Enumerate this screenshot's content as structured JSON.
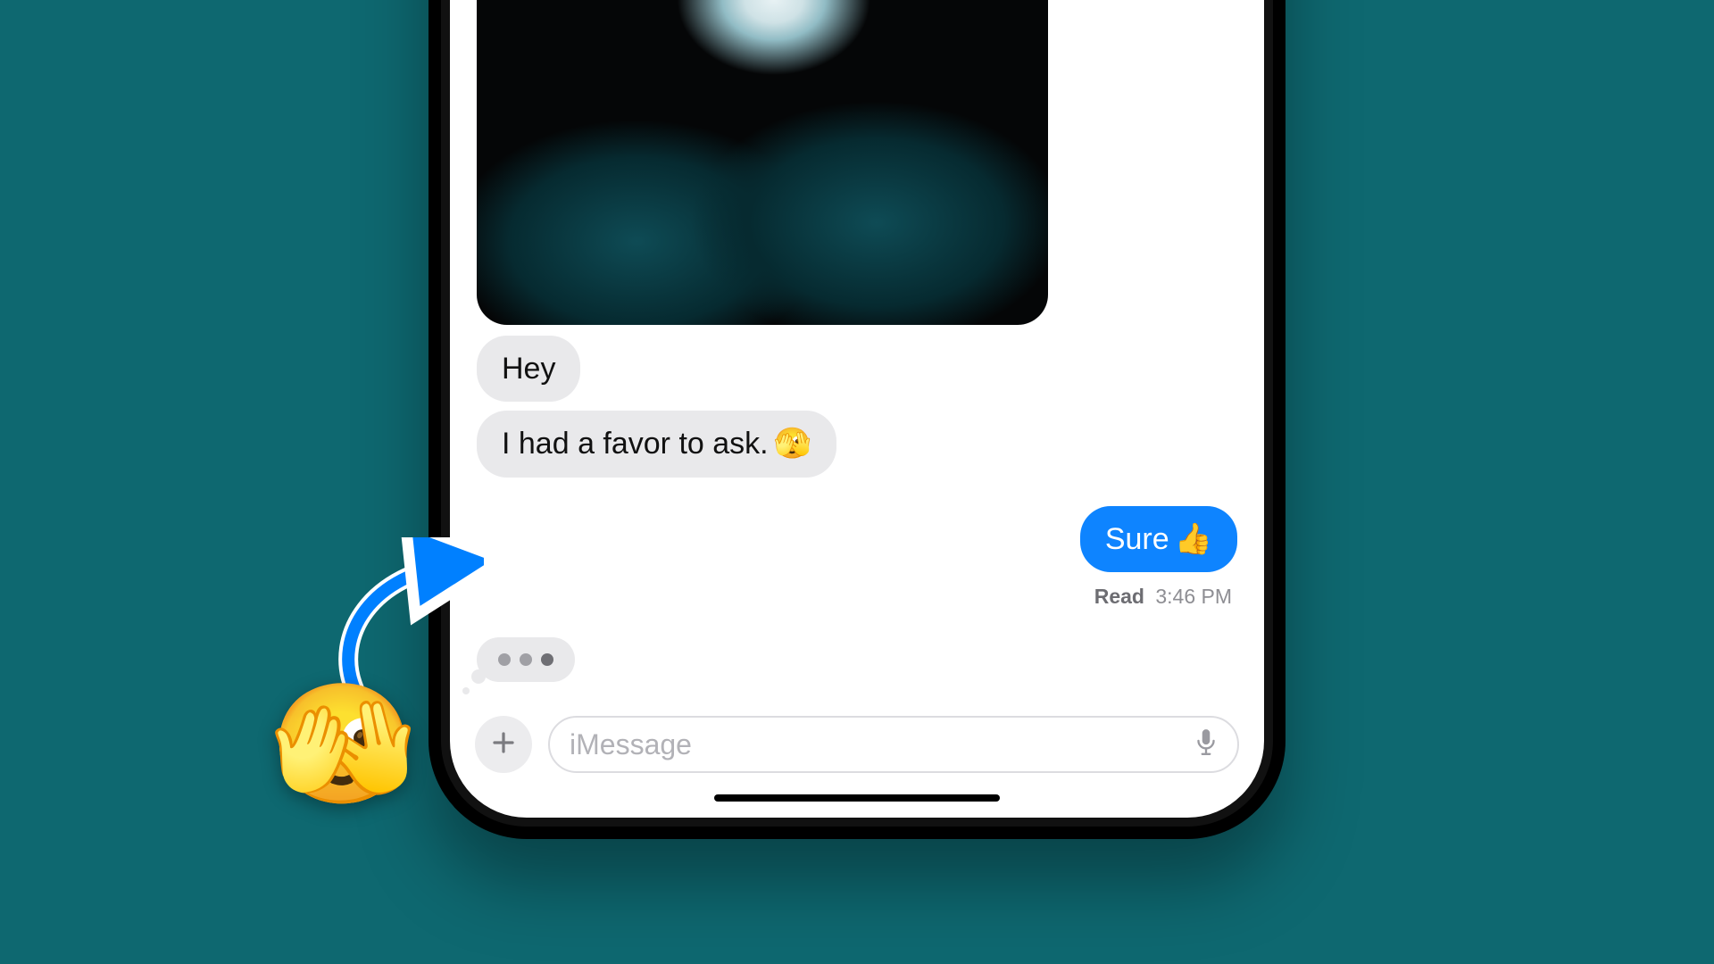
{
  "conversation": {
    "incoming": [
      {
        "text": "Hey"
      },
      {
        "text": "I had a favor to ask.",
        "emoji": "🫣"
      }
    ],
    "outgoing": [
      {
        "text": "Sure",
        "emoji": "👍"
      }
    ],
    "receipt": {
      "label": "Read",
      "time": "3:46 PM"
    },
    "typing_indicator": true
  },
  "compose": {
    "placeholder": "iMessage",
    "plus_icon": "plus-icon",
    "mic_icon": "mic-icon"
  },
  "annotation": {
    "arrow": "arrow-icon",
    "emoji": "🫣"
  }
}
